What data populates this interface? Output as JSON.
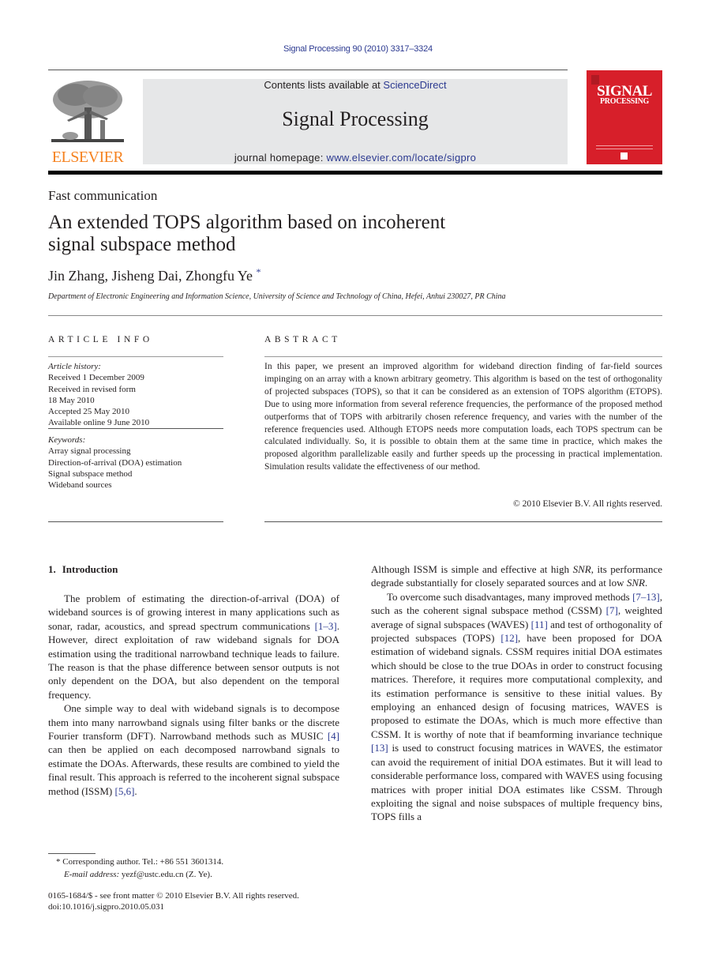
{
  "header": {
    "citation": "Signal Processing 90 (2010) 3317–3324",
    "contents_prefix": "Contents lists available at ",
    "contents_link": "ScienceDirect",
    "journal_title": "Signal Processing",
    "homepage_prefix": "journal homepage: ",
    "homepage_link": "www.elsevier.com/locate/sigpro",
    "publisher_logo_text": "ELSEVIER",
    "cover_title": "SIGNAL",
    "cover_subtitle": "PROCESSING",
    "colors": {
      "link": "#2b3990",
      "elsevier_orange": "#f58220",
      "cover_red": "#d71f2a",
      "banner_gray": "#e6e7e8"
    }
  },
  "article": {
    "type": "Fast communication",
    "title_line1": "An extended TOPS algorithm based on incoherent",
    "title_line2": "signal subspace method",
    "authors": "Jin Zhang, Jisheng Dai, Zhongfu Ye",
    "corresponding_mark": "*",
    "affiliation": "Department of Electronic Engineering and Information Science, University of Science and Technology of China, Hefei, Anhui 230027, PR China"
  },
  "article_info": {
    "heading": "ARTICLE INFO",
    "history_label": "Article history:",
    "history": [
      "Received 1 December 2009",
      "Received in revised form",
      "18 May 2010",
      "Accepted 25 May 2010",
      "Available online 9 June 2010"
    ],
    "keywords_label": "Keywords:",
    "keywords": [
      "Array signal processing",
      "Direction-of-arrival (DOA) estimation",
      "Signal subspace method",
      "Wideband sources"
    ]
  },
  "abstract": {
    "heading": "ABSTRACT",
    "text": "In this paper, we present an improved algorithm for wideband direction finding of far-field sources impinging on an array with a known arbitrary geometry. This algorithm is based on the test of orthogonality of projected subspaces (TOPS), so that it can be considered as an extension of TOPS algorithm (ETOPS). Due to using more information from several reference frequencies, the performance of the proposed method outperforms that of TOPS with arbitrarily chosen reference frequency, and varies with the number of the reference frequencies used. Although ETOPS needs more computation loads, each TOPS spectrum can be calculated individually. So, it is possible to obtain them at the same time in practice, which makes the proposed algorithm parallelizable easily and further speeds up the processing in practical implementation. Simulation results validate the effectiveness of our method.",
    "copyright": "© 2010 Elsevier B.V. All rights reserved."
  },
  "body": {
    "section_number": "1.",
    "section_title": "Introduction",
    "left_p1": [
      {
        "t": "The problem of estimating the direction-of-arrival (DOA) of wideband sources is of growing interest in many applications such as sonar, radar, acoustics, and spread spectrum communications "
      },
      {
        "ref": "[1–3]"
      },
      {
        "t": ". However, direct exploitation of raw wideband signals for DOA estimation using the traditional narrowband technique leads to failure. The reason is that the phase difference between sensor outputs is not only dependent on the DOA, but also dependent on the temporal frequency."
      }
    ],
    "left_p2": [
      {
        "t": "One simple way to deal with wideband signals is to decompose them into many narrowband signals using filter banks or the discrete Fourier transform (DFT). Narrowband methods such as MUSIC "
      },
      {
        "ref": "[4]"
      },
      {
        "t": " can then be applied on each decomposed narrowband signals to estimate the DOAs. Afterwards, these results are combined to yield the final result. This approach is referred to the incoherent signal subspace method (ISSM) "
      },
      {
        "ref": "[5,6]"
      },
      {
        "t": "."
      }
    ],
    "right_p1": [
      {
        "t": "Although ISSM is simple and effective at high "
      },
      {
        "i": "SNR"
      },
      {
        "t": ", its performance degrade substantially for closely separated sources and at low "
      },
      {
        "i": "SNR"
      },
      {
        "t": "."
      }
    ],
    "right_p2": [
      {
        "t": "To overcome such disadvantages, many improved methods "
      },
      {
        "ref": "[7–13]"
      },
      {
        "t": ", such as the coherent signal subspace method (CSSM) "
      },
      {
        "ref": "[7]"
      },
      {
        "t": ", weighted average of signal subspaces (WAVES) "
      },
      {
        "ref": "[11]"
      },
      {
        "t": " and test of orthogonality of projected subspaces (TOPS) "
      },
      {
        "ref": "[12]"
      },
      {
        "t": ", have been proposed for DOA estimation of wideband signals. CSSM requires initial DOA estimates which should be close to the true DOAs in order to construct focusing matrices. Therefore, it requires more computational complexity, and its estimation performance is sensitive to these initial values. By employing an enhanced design of focusing matrices, WAVES is proposed to estimate the DOAs, which is much more effective than CSSM. It is worthy of note that if beamforming invariance technique "
      },
      {
        "ref": "[13]"
      },
      {
        "t": " is used to construct focusing matrices in WAVES, the estimator can avoid the requirement of initial DOA estimates. But it will lead to considerable performance loss, compared with WAVES using focusing matrices with proper initial DOA estimates like CSSM. Through exploiting the signal and noise subspaces of multiple frequency bins, TOPS fills a"
      }
    ]
  },
  "footnotes": {
    "corresponding": "* Corresponding author. Tel.: +86 551 3601314.",
    "email_label": "E-mail address:",
    "email": "yezf@ustc.edu.cn",
    "email_suffix": " (Z. Ye).",
    "front_matter": "0165-1684/$ - see front matter © 2010 Elsevier B.V. All rights reserved.",
    "doi": "doi:10.1016/j.sigpro.2010.05.031"
  }
}
